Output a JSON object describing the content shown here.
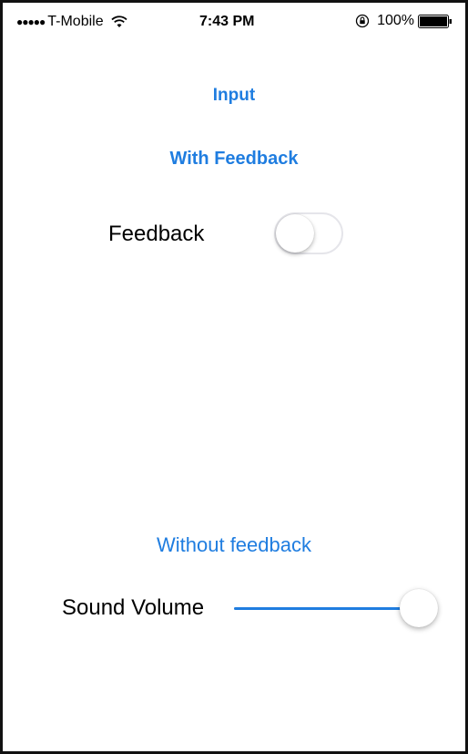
{
  "status_bar": {
    "signal": "●●●●●",
    "carrier": "T-Mobile",
    "time": "7:43 PM",
    "battery": "100%"
  },
  "main": {
    "title": "Input",
    "section_with_feedback": "With Feedback",
    "feedback_label": "Feedback",
    "feedback_on": false,
    "section_without_feedback": "Without feedback",
    "volume_label": "Sound Volume",
    "volume_value": 1.0
  },
  "colors": {
    "accent": "#1f7de0",
    "track": "#c7c7cc"
  }
}
